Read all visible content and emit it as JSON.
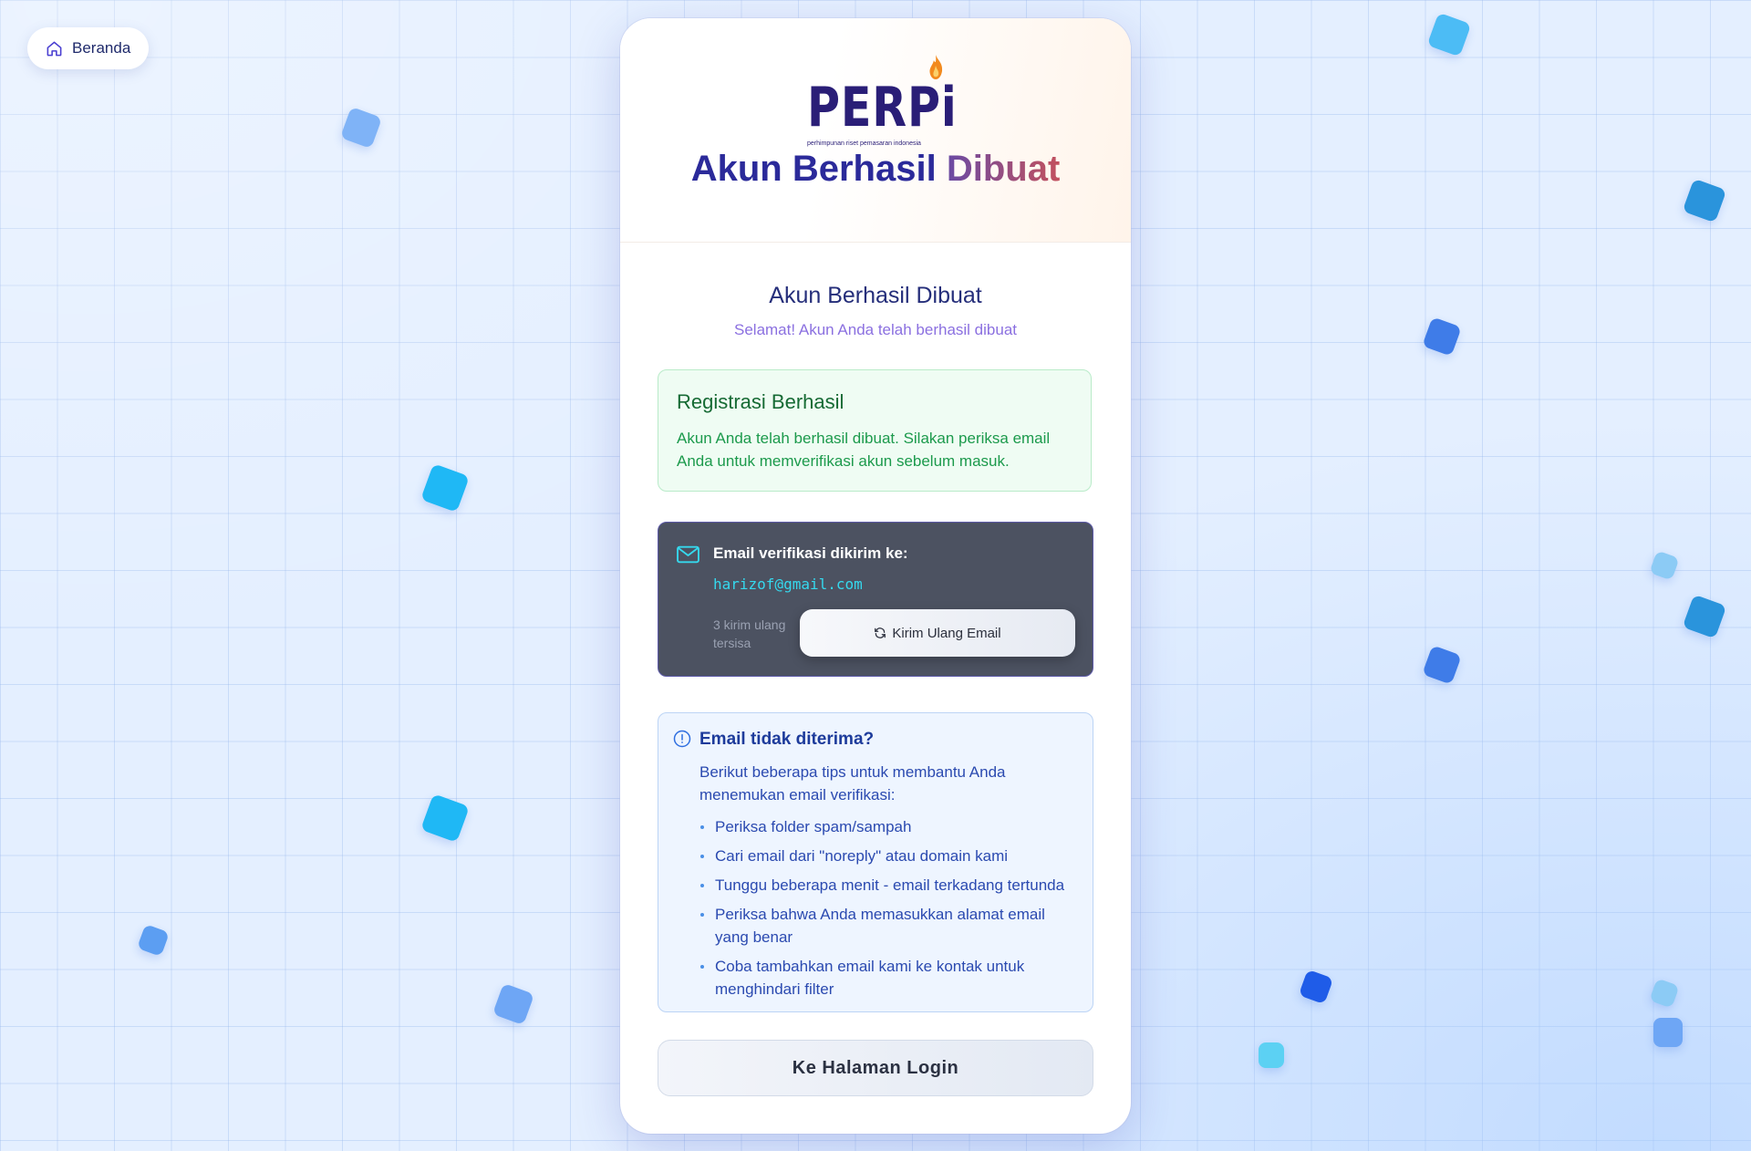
{
  "nav": {
    "home_label": "Beranda",
    "home_icon": "home-icon"
  },
  "logo": {
    "text": "PERPi",
    "subtitle": "perhimpunan riset pemasaran indonesia"
  },
  "header": {
    "title_part1": "Akun Berhasil",
    "title_part2": "Dibuat"
  },
  "page": {
    "title": "Akun Berhasil Dibuat",
    "subtitle": "Selamat! Akun Anda telah berhasil dibuat"
  },
  "success": {
    "title": "Registrasi Berhasil",
    "message": "Akun Anda telah berhasil dibuat. Silakan periksa email Anda untuk memverifikasi akun sebelum masuk."
  },
  "verification": {
    "label": "Email verifikasi dikirim ke:",
    "email": "harizof@gmail.com",
    "resend_remaining": "3 kirim ulang tersisa",
    "resend_button": "Kirim Ulang Email",
    "icon": "mail-icon"
  },
  "tips": {
    "title": "Email tidak diterima?",
    "intro": "Berikut beberapa tips untuk membantu Anda menemukan email verifikasi:",
    "items": [
      "Periksa folder spam/sampah",
      "Cari email dari \"noreply\" atau domain kami",
      "Tunggu beberapa menit - email terkadang tertunda",
      "Periksa bahwa Anda memasukkan alamat email yang benar",
      "Coba tambahkan email kami ke kontak untuk menghindari filter"
    ],
    "icon": "info-icon"
  },
  "login_button": "Ke Halaman Login",
  "colors": {
    "primary": "#2b2a9a",
    "success_bg": "#effcf3",
    "success_text": "#166a34",
    "email_box_bg": "#4c5261",
    "email_accent": "#35d9ee",
    "tips_bg": "#eef5ff",
    "tips_text": "#2b4ab0"
  }
}
